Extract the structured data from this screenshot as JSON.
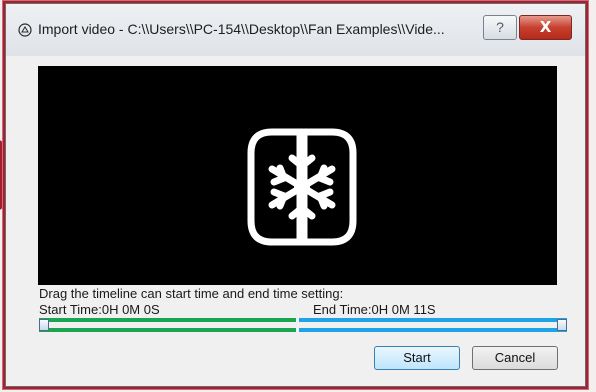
{
  "window": {
    "title": "Import video - C:\\\\Users\\\\PC-154\\\\Desktop\\\\Fan Examples\\\\Vide...",
    "help_label": "?",
    "close_label": "X",
    "title_icon": "import-circle-icon"
  },
  "preview": {
    "logo_icon": "snowflake-fan-logo-icon"
  },
  "timeline": {
    "instruction": "Drag the timeline can start time and end time setting:",
    "start_time_label": "Start Time:0H 0M 0S",
    "end_time_label": "End Time:0H 0M 11S",
    "start_color": "#1aa550",
    "end_color": "#1ea2e8",
    "start_position": 0,
    "end_position": 1
  },
  "buttons": {
    "start_label": "Start",
    "cancel_label": "Cancel"
  },
  "colors": {
    "frame_accent": "#a5202e",
    "dialog_background": "#f0f0f0",
    "video_background": "#000000"
  }
}
